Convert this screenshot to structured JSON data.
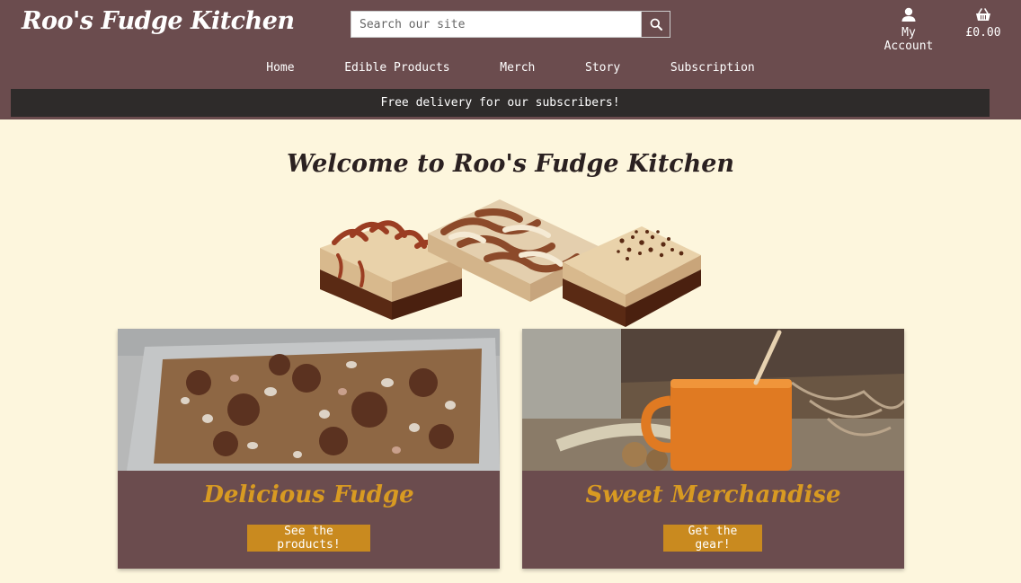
{
  "header": {
    "logo": "Roo's Fudge Kitchen",
    "search": {
      "placeholder": "Search our site"
    },
    "account_label": "My Account",
    "basket_total": "£0.00"
  },
  "nav": {
    "items": [
      "Home",
      "Edible Products",
      "Merch",
      "Story",
      "Subscription"
    ]
  },
  "banner": {
    "text": "Free delivery for our subscribers!"
  },
  "main": {
    "welcome": "Welcome to Roo's Fudge Kitchen",
    "cards": [
      {
        "title": "Delicious Fudge",
        "button": "See the products!"
      },
      {
        "title": "Sweet Merchandise",
        "button": "Get the gear!"
      }
    ]
  },
  "colors": {
    "brand": "#6b4c4e",
    "accent": "#c98a1f",
    "title_gold": "#d89a22",
    "background": "#fdf6dd",
    "banner": "#2e2b2a"
  },
  "icons": {
    "search": "search-icon",
    "account": "user-icon",
    "basket": "basket-icon"
  }
}
